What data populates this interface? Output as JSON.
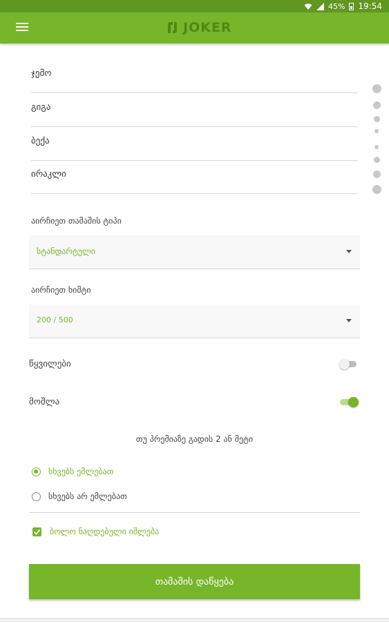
{
  "status_bar": {
    "battery": "45%",
    "time": "19:54"
  },
  "app": {
    "logo_text": "JOKER",
    "accent": "#77b52a",
    "status_bar_color": "#5f9720"
  },
  "players": [
    "ჯემო",
    "გიგა",
    "ბექა",
    "ირაკლი"
  ],
  "game_type": {
    "label": "აირჩიეთ თამაშის ტიპი",
    "value": "სტანდარტული"
  },
  "penalty": {
    "label": "აირჩიეთ ხიშტი",
    "value": "200 / 500"
  },
  "toggles": [
    {
      "label": "წყვილები",
      "on": false
    },
    {
      "label": "მოშლა",
      "on": true
    }
  ],
  "info_text": "თუ პრემიაზე გადის 2 ან მეტი",
  "radio_options": [
    {
      "label": "სხვებს ემლებათ",
      "checked": true
    },
    {
      "label": "სხვებს არ ემლებათ",
      "checked": false
    }
  ],
  "checkbox": {
    "label": "ბოლო ნაღდებული იშლება",
    "checked": true
  },
  "start_button": {
    "label": "თამაშის დაწყება"
  }
}
